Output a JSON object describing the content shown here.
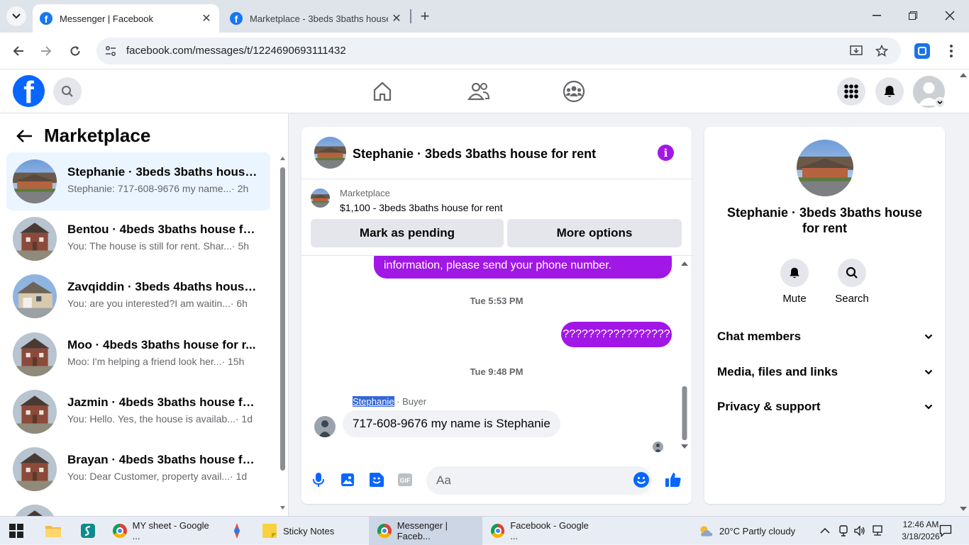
{
  "browser": {
    "tabs": [
      {
        "title": "Messenger | Facebook",
        "active": true
      },
      {
        "title": "Marketplace - 3beds 3baths house",
        "active": false
      }
    ],
    "url": "facebook.com/messages/t/1224690693111432"
  },
  "sidebar": {
    "title": "Marketplace",
    "conversations": [
      {
        "name": "Stephanie · 3beds 3baths house ...",
        "snippet": "Stephanie: 717-608-9676 my name...",
        "time": "· 2h",
        "selected": true
      },
      {
        "name": "Bentou · 4beds 3baths house for...",
        "snippet": "You: The house is still for rent. Shar...",
        "time": "· 5h",
        "selected": false
      },
      {
        "name": "Zavqiddin · 3beds 4baths house ...",
        "snippet": "You: are you interested?I am waitin...",
        "time": "· 6h",
        "selected": false
      },
      {
        "name": "Moo · 4beds 3baths house for r...",
        "snippet": "Moo: I'm helping a friend look her...",
        "time": "· 15h",
        "selected": false
      },
      {
        "name": "Jazmin · 4beds 3baths house for...",
        "snippet": "You: Hello. Yes, the house is availab...",
        "time": "· 1d",
        "selected": false
      },
      {
        "name": "Brayan · 4beds 3baths house for...",
        "snippet": "You: Dear Customer, property avail...",
        "time": "· 1d",
        "selected": false
      }
    ]
  },
  "chat": {
    "title": "Stephanie · 3beds 3baths house for rent",
    "marketplace_label": "Marketplace",
    "listing": "$1,100 - 3beds 3baths house for rent",
    "mark_pending": "Mark as pending",
    "more_options": "More options",
    "messages": {
      "partial_out": "information, please send your phone number.",
      "ts1": "Tue 5:53 PM",
      "out2": "?????????????????",
      "ts2": "Tue 9:48 PM",
      "sender_name": "Stephanie",
      "sender_role": "· Buyer",
      "in1": "717-608-9676 my name is Stephanie"
    },
    "input_placeholder": "Aa"
  },
  "info_panel": {
    "title": "Stephanie · 3beds 3baths house for rent",
    "actions": [
      {
        "label": "Mute",
        "icon": "bell-icon"
      },
      {
        "label": "Search",
        "icon": "search-icon"
      }
    ],
    "sections": [
      "Chat members",
      "Media, files and links",
      "Privacy & support"
    ]
  },
  "taskbar": {
    "items": [
      {
        "label": "MY sheet - Google ..."
      },
      {
        "label": "Sticky Notes"
      },
      {
        "label": "Messenger | Faceb..."
      },
      {
        "label": "Facebook - Google ..."
      }
    ],
    "weather": "20°C  Partly cloudy",
    "time": "12:46 AM",
    "date": "3/18/2026"
  },
  "colors": {
    "fb_blue": "#0866ff",
    "messenger_purple": "#a117e6",
    "selected_bg": "#ebf5ff"
  }
}
